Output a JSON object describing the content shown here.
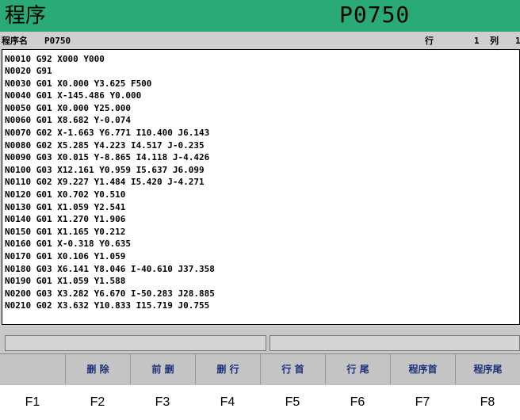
{
  "title": {
    "left": "程序",
    "center": "P0750"
  },
  "info": {
    "program_label": "程序名",
    "program_value": "P0750",
    "row_label": "行",
    "row_value": "1",
    "col_label": "列",
    "col_value": "1"
  },
  "code_lines": [
    "N0010 G92 X000 Y000",
    "N0020 G91",
    "N0030 G01 X0.000 Y3.625 F500",
    "N0040 G01 X-145.486 Y0.000",
    "N0050 G01 X0.000 Y25.000",
    "N0060 G01 X8.682 Y-0.074",
    "N0070 G02 X-1.663 Y6.771 I10.400 J6.143",
    "N0080 G02 X5.285 Y4.223 I4.517 J-0.235",
    "N0090 G03 X0.015 Y-8.865 I4.118 J-4.426",
    "N0100 G03 X12.161 Y0.959 I5.637 J6.099",
    "N0110 G02 X9.227 Y1.484 I5.420 J-4.271",
    "N0120 G01 X0.702 Y0.510",
    "N0130 G01 X1.059 Y2.541",
    "N0140 G01 X1.270 Y1.906",
    "N0150 G01 X1.165 Y0.212",
    "N0160 G01 X-0.318 Y0.635",
    "N0170 G01 X0.106 Y1.059",
    "N0180 G03 X6.141 Y8.046 I-40.610 J37.358",
    "N0190 G01 X1.059 Y1.588",
    "N0200 G03 X3.282 Y6.670 I-50.283 J28.885",
    "N0210 G02 X3.632 Y10.833 I15.719 J0.755"
  ],
  "softkeys": [
    "",
    "删 除",
    "前 删",
    "删 行",
    "行 首",
    "行 尾",
    "程序首",
    "程序尾"
  ],
  "fkeys": [
    "F1",
    "F2",
    "F3",
    "F4",
    "F5",
    "F6",
    "F7",
    "F8"
  ],
  "colors": {
    "title_bg": "#2aaa76",
    "panel_bg": "#cfcfcf",
    "softkey_text": "#1c2f7a"
  }
}
